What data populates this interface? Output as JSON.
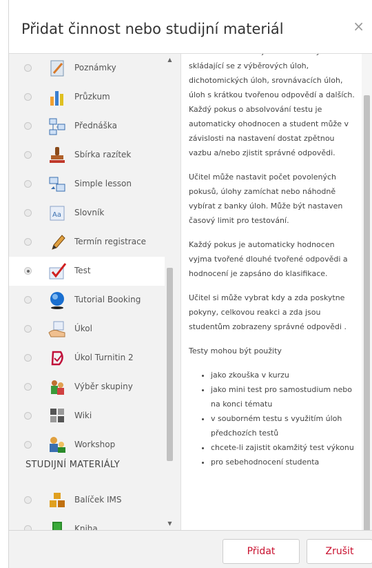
{
  "dialog": {
    "title": "Přidat činnost nebo studijní materiál",
    "close_glyph": "×"
  },
  "activities": [
    {
      "label": "Poznámky",
      "icon": "notes-icon",
      "selected": false
    },
    {
      "label": "Průzkum",
      "icon": "survey-icon",
      "selected": false
    },
    {
      "label": "Přednáška",
      "icon": "lesson-icon",
      "selected": false
    },
    {
      "label": "Sbírka razítek",
      "icon": "stamp-icon",
      "selected": false
    },
    {
      "label": "Simple lesson",
      "icon": "simple-lesson-icon",
      "selected": false
    },
    {
      "label": "Slovník",
      "icon": "glossary-icon",
      "selected": false
    },
    {
      "label": "Termín registrace",
      "icon": "pencil-icon",
      "selected": false
    },
    {
      "label": "Test",
      "icon": "quiz-check-icon",
      "selected": true
    },
    {
      "label": "Tutorial Booking",
      "icon": "globe-icon",
      "selected": false
    },
    {
      "label": "Úkol",
      "icon": "assignment-hand-icon",
      "selected": false
    },
    {
      "label": "Úkol Turnitin 2",
      "icon": "turnitin-icon",
      "selected": false
    },
    {
      "label": "Výběr skupiny",
      "icon": "group-choice-icon",
      "selected": false
    },
    {
      "label": "Wiki",
      "icon": "wiki-icon",
      "selected": false
    },
    {
      "label": "Workshop",
      "icon": "workshop-icon",
      "selected": false
    }
  ],
  "resources_heading": "STUDIJNÍ MATERIÁLY",
  "resources": [
    {
      "label": "Balíček IMS",
      "icon": "ims-package-icon",
      "selected": false
    },
    {
      "label": "Kniha",
      "icon": "book-icon",
      "selected": false
    }
  ],
  "description": {
    "p1": "Modul Test umožňuje vkládat testy skládající se z výběrových úloh, dichotomických úloh, srovnávacích úloh, úloh s krátkou tvořenou odpovědí a dalších. Každý pokus o absolvování testu je automaticky ohodnocen a student může v závislosti na nastavení dostat zpětnou vazbu a/nebo zjistit správné odpovědi.",
    "p2": "Učitel může nastavit počet povolených pokusů, úlohy zamíchat nebo náhodně vybírat z banky úloh. Může být nastaven časový limit pro testování.",
    "p3": "Každý pokus je automaticky hodnocen vyjma tvořené dlouhé tvořené odpovědi a hodnocení je zapsáno do klasifikace.",
    "p4": "Učitel si může vybrat kdy a zda poskytne pokyny, celkovou reakci a zda jsou studentům zobrazeny správné odpovědi .",
    "p5": "Testy mohou být použity",
    "uses": [
      "jako zkouška v kurzu",
      "jako mini test pro samostudium nebo na konci tématu",
      "v souborném testu s využitím úloh předchozích testů",
      "chcete-li zajistit okamžitý test výkonu",
      "pro sebehodnocení studenta"
    ]
  },
  "footer": {
    "add_label": "Přidat",
    "cancel_label": "Zrušit"
  },
  "colors": {
    "accent": "#c8102e",
    "pane_bg": "#f2f2f2"
  }
}
